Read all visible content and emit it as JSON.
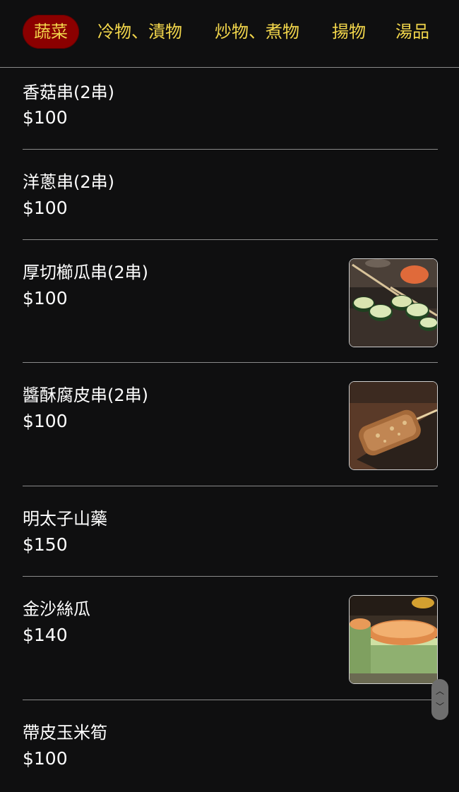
{
  "tabs": [
    {
      "label": "蔬菜",
      "active": true
    },
    {
      "label": "冷物、漬物",
      "active": false
    },
    {
      "label": "炒物、煮物",
      "active": false
    },
    {
      "label": "揚物",
      "active": false
    },
    {
      "label": "湯品",
      "active": false
    }
  ],
  "items": [
    {
      "name": "香菇串(2串)",
      "price": "$100",
      "image": null
    },
    {
      "name": "洋蔥串(2串)",
      "price": "$100",
      "image": null
    },
    {
      "name": "厚切櫛瓜串(2串)",
      "price": "$100",
      "image": "zucchini-skewer-photo"
    },
    {
      "name": "醬酥腐皮串(2串)",
      "price": "$100",
      "image": "tofu-skin-skewer-photo"
    },
    {
      "name": "明太子山藥",
      "price": "$150",
      "image": null
    },
    {
      "name": "金沙絲瓜",
      "price": "$140",
      "image": "luffa-photo"
    },
    {
      "name": "帶皮玉米筍",
      "price": "$100",
      "image": null
    }
  ],
  "colors": {
    "background": "#0f0f10",
    "tab_text": "#f2d64b",
    "tab_active_bg": "#8b0000",
    "divider": "#8a8a8a"
  },
  "icons": {
    "scroll_up": "chevron-up-icon",
    "scroll_down": "chevron-down-icon"
  }
}
